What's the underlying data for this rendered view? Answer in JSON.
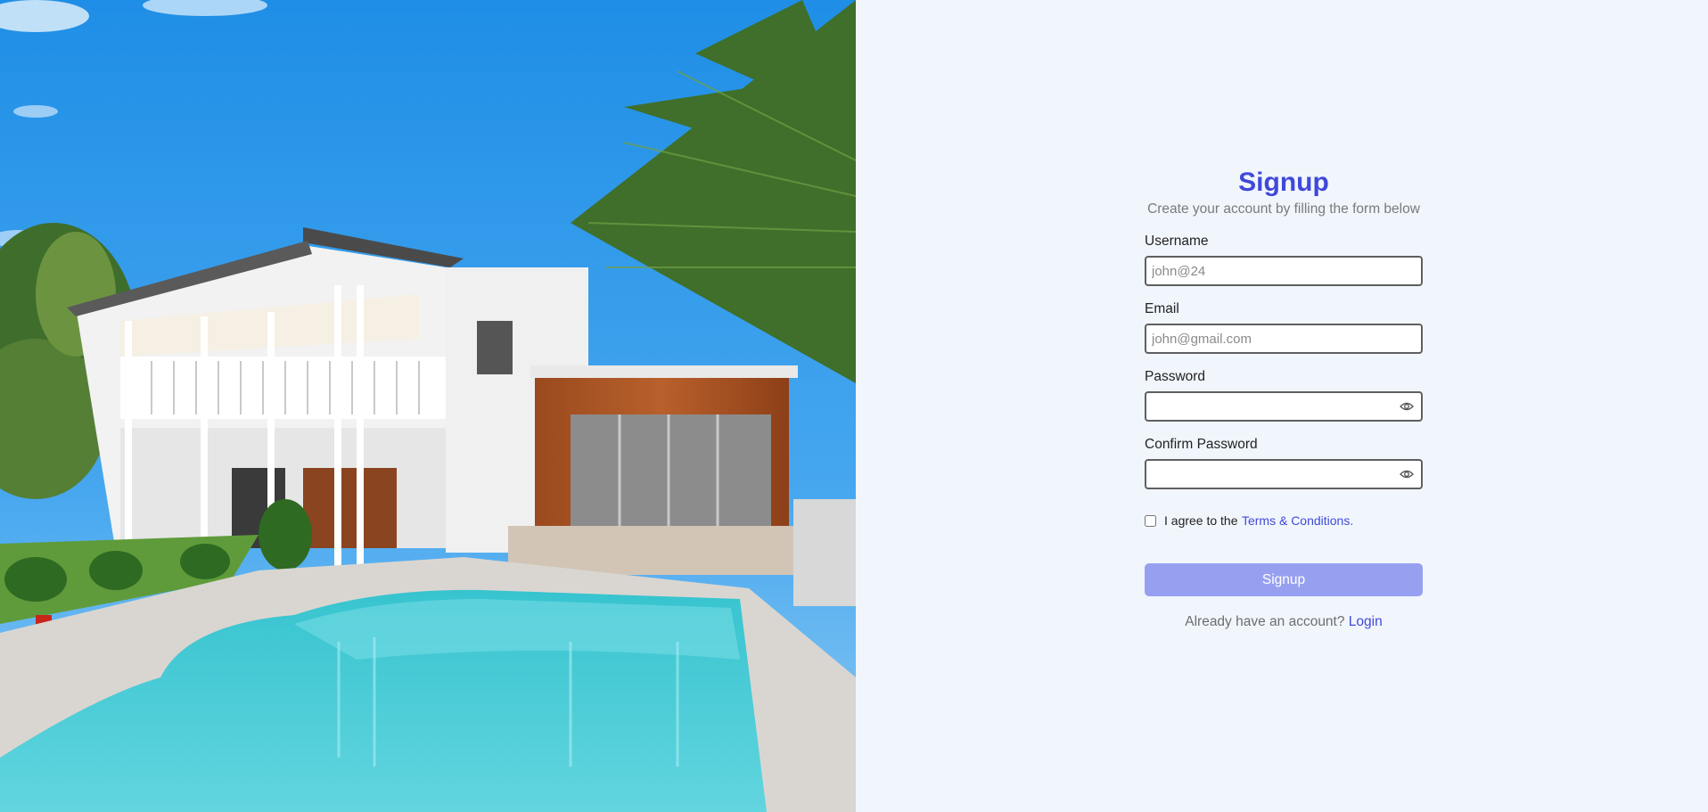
{
  "hero": {
    "image": "house-with-pool-photo"
  },
  "form": {
    "title": "Signup",
    "subtitle": "Create your account by filling the form below",
    "username": {
      "label": "Username",
      "placeholder": "john@24",
      "value": ""
    },
    "email": {
      "label": "Email",
      "placeholder": "john@gmail.com",
      "value": ""
    },
    "password": {
      "label": "Password",
      "placeholder": "",
      "value": "",
      "toggle_icon": "eye-icon"
    },
    "confirm_password": {
      "label": "Confirm Password",
      "placeholder": "",
      "value": "",
      "toggle_icon": "eye-icon"
    },
    "terms": {
      "prefix": "I agree to the ",
      "link_text": "Terms & Conditions",
      "suffix": ".",
      "checked": false
    },
    "submit_label": "Signup",
    "footer": {
      "question": "Already have an account? ",
      "login_label": "Login"
    }
  },
  "colors": {
    "accent": "#4049d8",
    "button": "#97a0f0",
    "panel_bg": "#f1f6fd"
  }
}
